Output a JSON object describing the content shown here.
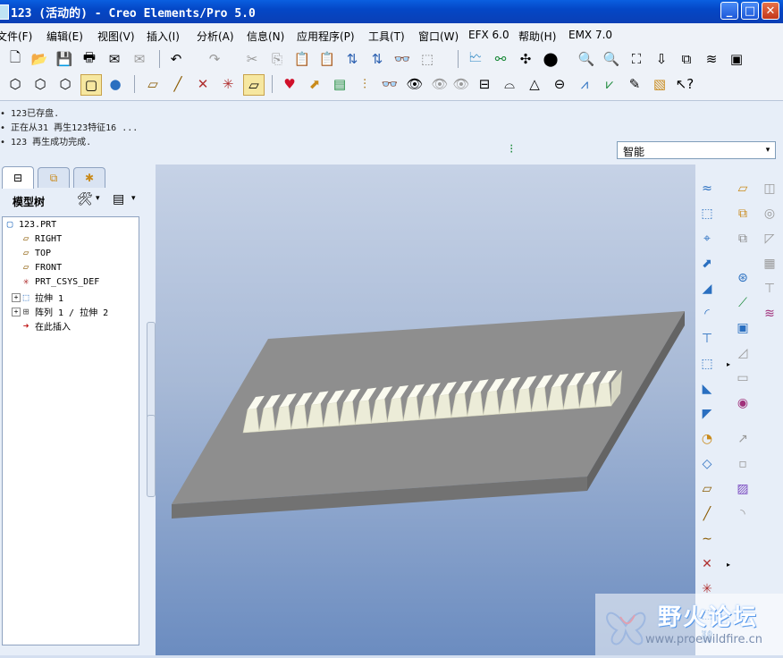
{
  "window": {
    "title": "123 (活动的) - Creo Elements/Pro 5.0",
    "controls": {
      "minimize": "_",
      "maximize": "□",
      "close": "✕"
    }
  },
  "menu": {
    "items": [
      "文件(F)",
      "编辑(E)",
      "视图(V)",
      "插入(I)",
      "分析(A)",
      "信息(N)",
      "应用程序(P)",
      "工具(T)",
      "窗口(W)",
      "EFX 6.0",
      "帮助(H)",
      "EMX 7.0"
    ]
  },
  "messages": [
    "• 123已存盘.",
    "• 正在从31 再生123特征16 ...",
    "• 123 再生成功完成."
  ],
  "filter": {
    "value": "智能",
    "arrow": "▾"
  },
  "left_panel": {
    "tabs": [
      "model-tree-tab",
      "layers-tab",
      "folder-tab"
    ],
    "header": {
      "label": "模型树",
      "settings_arrow": "▾",
      "show_arrow": "▾"
    },
    "tree": [
      {
        "label": "123.PRT",
        "icon": "part-icon",
        "glyph": "▢",
        "expander": ""
      },
      {
        "label": "RIGHT",
        "icon": "datum-plane-icon",
        "glyph": "▱",
        "expander": ""
      },
      {
        "label": "TOP",
        "icon": "datum-plane-icon",
        "glyph": "▱",
        "expander": ""
      },
      {
        "label": "FRONT",
        "icon": "datum-plane-icon",
        "glyph": "▱",
        "expander": ""
      },
      {
        "label": "PRT_CSYS_DEF",
        "icon": "coordinate-system-icon",
        "glyph": "✳",
        "expander": ""
      },
      {
        "label": "拉伸 1",
        "icon": "extrude-icon",
        "glyph": "⬚",
        "expander": "+"
      },
      {
        "label": "阵列 1 / 拉伸 2",
        "icon": "pattern-icon",
        "glyph": "⊞",
        "expander": "+"
      },
      {
        "label": "在此插入",
        "icon": "insert-here-arrow-icon",
        "glyph": "➜",
        "expander": ""
      }
    ]
  },
  "watermark": {
    "text": "野火论坛",
    "url": "www.proewildfire.cn"
  },
  "colors": {
    "titlebar": "#0a4fd2",
    "chrome": "#e7eef8",
    "viewport_top": "#c6d2e6",
    "viewport_bottom": "#6b8cc0",
    "plate_top": "#8c8c8c",
    "plate_side": "#777777",
    "teeth": "#f4f4e6"
  }
}
